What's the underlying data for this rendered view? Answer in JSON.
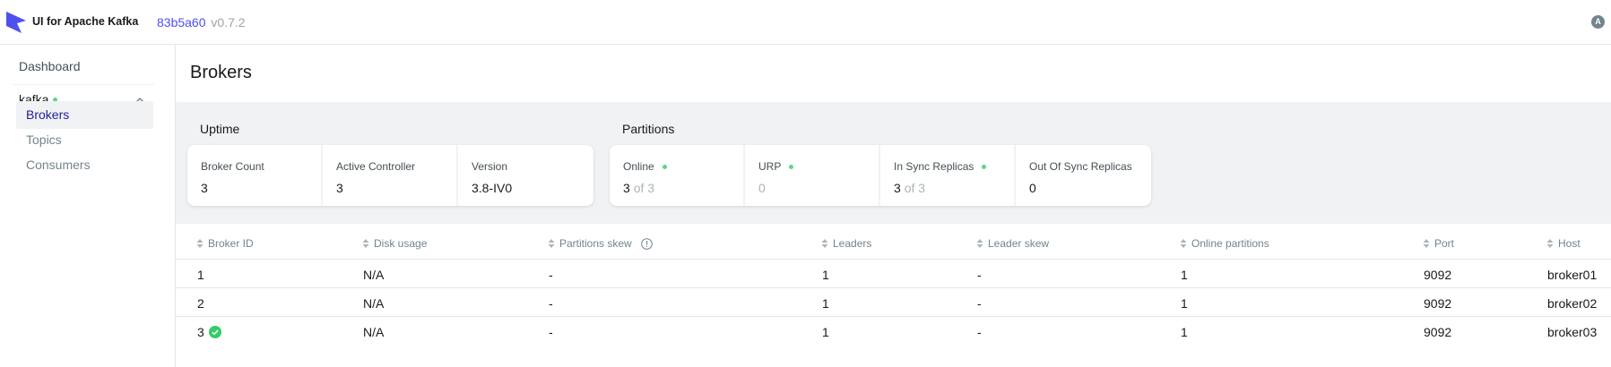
{
  "app": {
    "title": "UI for Apache Kafka",
    "version_hash": "83b5a60",
    "version_tag": "v0.7.2",
    "avatar_letter": "A",
    "logo_icon": "kafka-ui-logo-icon",
    "brand_color": "#4f4ff0"
  },
  "sidebar": {
    "dashboard_label": "Dashboard",
    "cluster_name": "kafka",
    "cluster_status_color": "#5cd685",
    "items": [
      {
        "label": "Brokers",
        "active": true
      },
      {
        "label": "Topics",
        "active": false
      },
      {
        "label": "Consumers",
        "active": false
      }
    ]
  },
  "page": {
    "title": "Brokers"
  },
  "uptime": {
    "title": "Uptime",
    "cards": [
      {
        "label": "Broker Count",
        "value": "3"
      },
      {
        "label": "Active Controller",
        "value": "3"
      },
      {
        "label": "Version",
        "value": "3.8-IV0"
      }
    ]
  },
  "partitions": {
    "title": "Partitions",
    "cards": [
      {
        "label": "Online",
        "value": "3",
        "suffix": "of 3"
      },
      {
        "label": "URP",
        "value": "0"
      },
      {
        "label": "In Sync Replicas",
        "value": "3",
        "suffix": "of 3"
      },
      {
        "label": "Out Of Sync Replicas",
        "value": "0"
      }
    ]
  },
  "table": {
    "columns": [
      "Broker ID",
      "Disk usage",
      "Partitions skew",
      "Leaders",
      "Leader skew",
      "Online partitions",
      "Port",
      "Host"
    ],
    "rows": [
      {
        "broker_id": "1",
        "disk_usage": "N/A",
        "partitions_skew": "-",
        "leaders": "1",
        "leader_skew": "-",
        "online_partitions": "1",
        "port": "9092",
        "host": "broker01",
        "controller": false
      },
      {
        "broker_id": "2",
        "disk_usage": "N/A",
        "partitions_skew": "-",
        "leaders": "1",
        "leader_skew": "-",
        "online_partitions": "1",
        "port": "9092",
        "host": "broker02",
        "controller": false
      },
      {
        "broker_id": "3",
        "disk_usage": "N/A",
        "partitions_skew": "-",
        "leaders": "1",
        "leader_skew": "-",
        "online_partitions": "1",
        "port": "9092",
        "host": "broker03",
        "controller": true
      }
    ]
  }
}
